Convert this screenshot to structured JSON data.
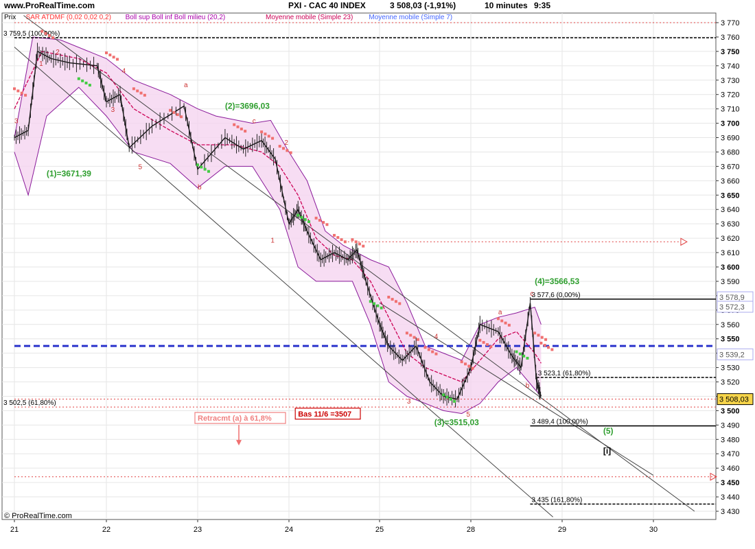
{
  "header": {
    "site": "www.ProRealTime.com",
    "title": "PXI - CAC 40 INDEX",
    "quote": "3 508,03  (-1,91%)",
    "timeframe": "10 minutes",
    "time": "9:35"
  },
  "legend": [
    {
      "label": "Prix",
      "color": "#000000"
    },
    {
      "label": "SAR ATDMF (0,02 0,02 0,2)",
      "color": "#ff3333"
    },
    {
      "label": "Boll sup Boll inf Boll milieu (20,2)",
      "color": "#aa00aa"
    },
    {
      "label": "Moyenne mobile (Simple 23)",
      "color": "#cc0055"
    },
    {
      "label": "Moyenne mobile (Simple 7)",
      "color": "#4466ff"
    }
  ],
  "footer": {
    "copyright": "© ProRealTime.com"
  },
  "chart_data": {
    "type": "line",
    "ylim": [
      3425,
      3775
    ],
    "yticks": [
      3430,
      3440,
      3450,
      3460,
      3470,
      3480,
      3490,
      3500,
      3510,
      3520,
      3530,
      3540,
      3550,
      3560,
      3570,
      3580,
      3590,
      3600,
      3610,
      3620,
      3630,
      3640,
      3650,
      3660,
      3670,
      3680,
      3690,
      3700,
      3710,
      3720,
      3730,
      3740,
      3750,
      3760,
      3770
    ],
    "major_yticks": [
      3450,
      3500,
      3550,
      3600,
      3650,
      3700,
      3750
    ],
    "ytick_labels": [
      "3 430",
      "3 440",
      "3 450",
      "3 460",
      "3 470",
      "3 480",
      "3 490",
      "3 500",
      "3 510",
      "3 520",
      "3 530",
      "3 540",
      "3 550",
      "3 560",
      "3 570",
      "3 580",
      "3 590",
      "3 600",
      "3 610",
      "3 620",
      "3 630",
      "3 640",
      "3 650",
      "3 660",
      "3 670",
      "3 680",
      "3 690",
      "3 700",
      "3 710",
      "3 720",
      "3 730",
      "3 740",
      "3 750",
      "3 760",
      "3 770"
    ],
    "x_sessions": [
      "21",
      "22",
      "23",
      "24",
      "25",
      "28",
      "29",
      "30"
    ],
    "price_path": [
      [
        0,
        3690
      ],
      [
        0.15,
        3695
      ],
      [
        0.25,
        3750
      ],
      [
        0.4,
        3745
      ],
      [
        0.6,
        3742
      ],
      [
        0.9,
        3740
      ],
      [
        1.0,
        3715
      ],
      [
        1.15,
        3720
      ],
      [
        1.25,
        3683
      ],
      [
        1.5,
        3698
      ],
      [
        1.85,
        3712
      ],
      [
        2.0,
        3668
      ],
      [
        2.3,
        3690
      ],
      [
        2.5,
        3682
      ],
      [
        2.7,
        3688
      ],
      [
        2.85,
        3675
      ],
      [
        3.0,
        3630
      ],
      [
        3.1,
        3640
      ],
      [
        3.2,
        3625
      ],
      [
        3.35,
        3605
      ],
      [
        3.5,
        3610
      ],
      [
        3.65,
        3605
      ],
      [
        3.75,
        3612
      ],
      [
        3.85,
        3590
      ],
      [
        4.0,
        3560
      ],
      [
        4.1,
        3545
      ],
      [
        4.25,
        3535
      ],
      [
        4.4,
        3545
      ],
      [
        4.55,
        3520
      ],
      [
        4.7,
        3510
      ],
      [
        4.85,
        3508
      ],
      [
        5.0,
        3530
      ],
      [
        5.1,
        3560
      ],
      [
        5.3,
        3555
      ],
      [
        5.45,
        3538
      ],
      [
        5.55,
        3530
      ],
      [
        5.65,
        3575
      ],
      [
        5.72,
        3520
      ],
      [
        5.77,
        3510
      ]
    ],
    "sma_path": [
      [
        0,
        3710
      ],
      [
        0.3,
        3750
      ],
      [
        0.7,
        3745
      ],
      [
        1.0,
        3735
      ],
      [
        1.3,
        3710
      ],
      [
        1.7,
        3695
      ],
      [
        2.0,
        3685
      ],
      [
        2.4,
        3685
      ],
      [
        2.7,
        3680
      ],
      [
        2.9,
        3670
      ],
      [
        3.1,
        3650
      ],
      [
        3.3,
        3620
      ],
      [
        3.5,
        3608
      ],
      [
        3.7,
        3605
      ],
      [
        3.9,
        3590
      ],
      [
        4.1,
        3565
      ],
      [
        4.3,
        3540
      ],
      [
        4.5,
        3530
      ],
      [
        4.7,
        3525
      ],
      [
        4.9,
        3520
      ],
      [
        5.1,
        3535
      ],
      [
        5.3,
        3550
      ],
      [
        5.5,
        3555
      ],
      [
        5.7,
        3540
      ],
      [
        5.77,
        3533
      ]
    ],
    "boll_upper": [
      [
        0,
        3690
      ],
      [
        0.2,
        3760
      ],
      [
        0.5,
        3758
      ],
      [
        1.0,
        3745
      ],
      [
        1.3,
        3730
      ],
      [
        1.7,
        3720
      ],
      [
        2.0,
        3710
      ],
      [
        2.2,
        3705
      ],
      [
        2.6,
        3700
      ],
      [
        2.8,
        3702
      ],
      [
        3.0,
        3680
      ],
      [
        3.2,
        3660
      ],
      [
        3.4,
        3625
      ],
      [
        3.6,
        3615
      ],
      [
        3.9,
        3605
      ],
      [
        4.1,
        3600
      ],
      [
        4.3,
        3575
      ],
      [
        4.5,
        3545
      ],
      [
        4.7,
        3540
      ],
      [
        4.9,
        3535
      ],
      [
        5.1,
        3560
      ],
      [
        5.3,
        3565
      ],
      [
        5.5,
        3568
      ],
      [
        5.7,
        3572
      ],
      [
        5.77,
        3560
      ]
    ],
    "boll_lower": [
      [
        0,
        3680
      ],
      [
        0.15,
        3650
      ],
      [
        0.35,
        3705
      ],
      [
        0.7,
        3725
      ],
      [
        1.0,
        3705
      ],
      [
        1.3,
        3680
      ],
      [
        1.7,
        3672
      ],
      [
        2.0,
        3655
      ],
      [
        2.3,
        3670
      ],
      [
        2.6,
        3670
      ],
      [
        2.9,
        3640
      ],
      [
        3.1,
        3600
      ],
      [
        3.3,
        3590
      ],
      [
        3.5,
        3590
      ],
      [
        3.7,
        3590
      ],
      [
        3.9,
        3560
      ],
      [
        4.1,
        3520
      ],
      [
        4.3,
        3510
      ],
      [
        4.5,
        3505
      ],
      [
        4.7,
        3500
      ],
      [
        4.9,
        3498
      ],
      [
        5.1,
        3505
      ],
      [
        5.3,
        3520
      ],
      [
        5.5,
        3530
      ],
      [
        5.7,
        3515
      ],
      [
        5.77,
        3510
      ]
    ],
    "channel_lines": [
      {
        "from": [
          0.1,
          3775
        ],
        "to": [
          7.45,
          3430
        ]
      },
      {
        "from": [
          0,
          3753
        ],
        "to": [
          5.9,
          3426
        ]
      },
      {
        "from": [
          4.0,
          3575
        ],
        "to": [
          7.0,
          3455
        ]
      }
    ],
    "horizontal_levels": [
      {
        "y": 3770,
        "color": "#e04040",
        "style": "dotted",
        "from_x": 0,
        "to_x": 7.75
      },
      {
        "y": 3759.5,
        "color": "#000000",
        "style": "dashed",
        "from_x": 0,
        "to_x": 7.75,
        "label": "3 759,5 (100,00%)"
      },
      {
        "y": 3617.5,
        "color": "#e04040",
        "style": "dotted",
        "from_x": 3.65,
        "to_x": 7.3
      },
      {
        "y": 3577.6,
        "color": "#000000",
        "style": "solid",
        "from_x": 5.65,
        "to_x": 7.75,
        "label": "3 577,6 (0,00%)"
      },
      {
        "y": 3545,
        "color": "#2b34cc",
        "style": "bold-dashed",
        "from_x": 0,
        "to_x": 7.75
      },
      {
        "y": 3523.1,
        "color": "#000000",
        "style": "dashed",
        "from_x": 5.72,
        "to_x": 7.75,
        "label": "3 523,1 (61,80%)"
      },
      {
        "y": 3508,
        "color": "#e04040",
        "style": "dotted",
        "from_x": 0,
        "to_x": 7.75
      },
      {
        "y": 3502.5,
        "color": "#e04040",
        "style": "dotted",
        "from_x": 0,
        "to_x": 7.75,
        "label": "3 502,5 (61,80%)"
      },
      {
        "y": 3489.4,
        "color": "#000000",
        "style": "solid",
        "from_x": 5.65,
        "to_x": 7.75,
        "label": "3 489,4 (100,00%)"
      },
      {
        "y": 3454,
        "color": "#e04040",
        "style": "dotted",
        "from_x": 0,
        "to_x": 7.75
      },
      {
        "y": 3435,
        "color": "#000000",
        "style": "dashed",
        "from_x": 5.65,
        "to_x": 7.75,
        "label": "3 435 (161,80%)"
      }
    ],
    "wave_labels": [
      {
        "text": "(1)=3671,39",
        "x": 0.35,
        "y": 3663,
        "color": "#2e9e2e"
      },
      {
        "text": "(2)=3696,03",
        "x": 2.3,
        "y": 3710,
        "color": "#2e9e2e"
      },
      {
        "text": "(3)=3515,03",
        "x": 4.6,
        "y": 3490,
        "color": "#2e9e2e"
      },
      {
        "text": "(4)=3566,53",
        "x": 5.7,
        "y": 3588,
        "color": "#2e9e2e"
      },
      {
        "text": "(5)",
        "x": 6.45,
        "y": 3484,
        "color": "#2e9e2e"
      },
      {
        "text": "[i]",
        "x": 6.45,
        "y": 3470,
        "color": "#000000"
      }
    ],
    "small_labels": [
      {
        "text": "3",
        "x": 1.05,
        "y": 3708
      },
      {
        "text": "4",
        "x": 1.17,
        "y": 3735
      },
      {
        "text": "5",
        "x": 1.35,
        "y": 3668
      },
      {
        "text": "a",
        "x": 1.85,
        "y": 3725
      },
      {
        "text": "b",
        "x": 2.0,
        "y": 3654
      },
      {
        "text": "c",
        "x": 2.6,
        "y": 3700
      },
      {
        "text": "2",
        "x": 2.95,
        "y": 3685
      },
      {
        "text": "1",
        "x": 2.8,
        "y": 3617
      },
      {
        "text": "3",
        "x": 4.3,
        "y": 3505
      },
      {
        "text": "4",
        "x": 4.6,
        "y": 3550
      },
      {
        "text": "5",
        "x": 4.95,
        "y": 3496
      },
      {
        "text": "a",
        "x": 5.3,
        "y": 3567
      },
      {
        "text": "b",
        "x": 5.6,
        "y": 3516
      },
      {
        "text": "c",
        "x": 5.65,
        "y": 3580
      },
      {
        "text": "3",
        "x": 0.0,
        "y": 3700
      },
      {
        "text": "1",
        "x": 0.27,
        "y": 3740
      },
      {
        "text": "2",
        "x": 0.45,
        "y": 3748
      }
    ],
    "boxed_annotations": [
      {
        "text": "Retracmt (a) à 61,8%",
        "x": 2.0,
        "y": 3493,
        "color": "#f08080"
      },
      {
        "text": "Bas 11/6 =3507",
        "x": 3.1,
        "y": 3496,
        "color": "#cc0000"
      }
    ],
    "price_tags": [
      {
        "text": "3 578,9",
        "y": 3578.9,
        "style": "outline"
      },
      {
        "text": "3 572,3",
        "y": 3572.3,
        "style": "outline"
      },
      {
        "text": "3 539,2",
        "y": 3539.2,
        "style": "outline"
      },
      {
        "text": "3 508,03",
        "y": 3508.03,
        "style": "filled"
      }
    ],
    "current_price": 3508.03
  }
}
